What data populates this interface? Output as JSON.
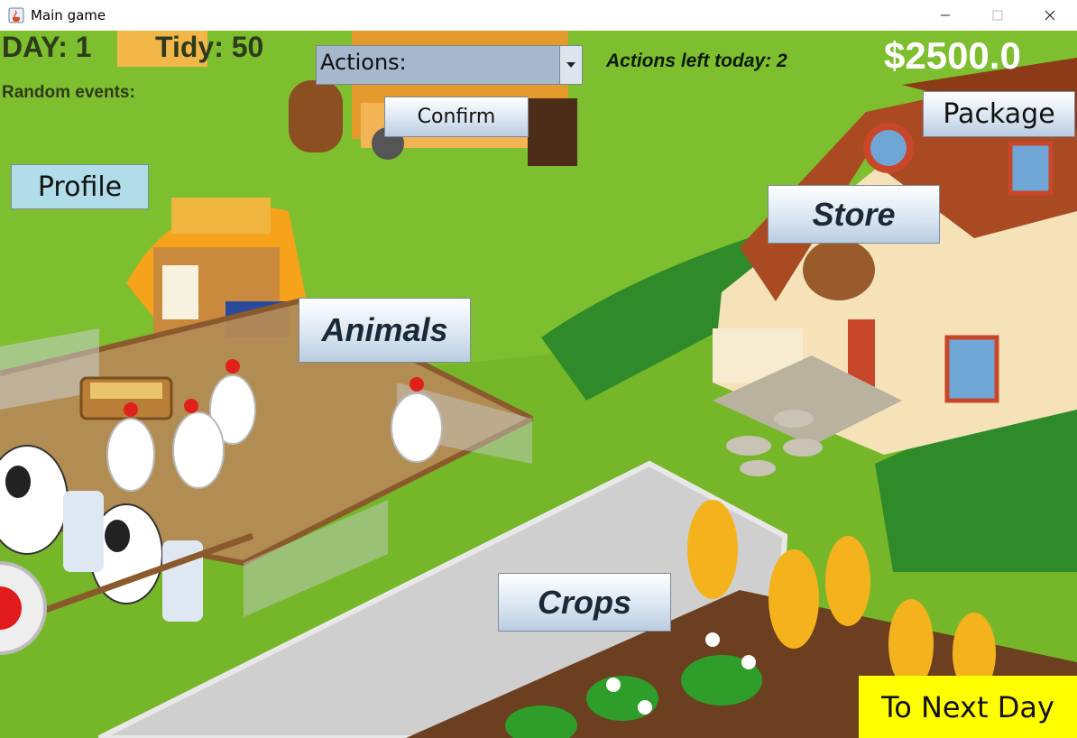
{
  "window": {
    "title": "Main game",
    "controls": {
      "minimize": "–",
      "maximize": "☐",
      "close": "✕"
    }
  },
  "hud": {
    "day": "DAY: 1",
    "tidy": "Tidy: 50",
    "random_events": "Random events:",
    "actions_left": "Actions left today: 2",
    "money": "$2500.0"
  },
  "actions_dropdown": {
    "selected": "Actions:",
    "arrow_icon": "caret-down-icon"
  },
  "buttons": {
    "confirm": "Confirm",
    "package": "Package",
    "profile": "Profile",
    "store": "Store",
    "animals": "Animals",
    "crops": "Crops",
    "next_day": "To Next Day"
  },
  "colors": {
    "grass": "#76b72a",
    "path": "#c9c9c9",
    "money": "#ffffff",
    "next_day_bg": "#ffff00",
    "profile_bg": "#b0dde8"
  }
}
